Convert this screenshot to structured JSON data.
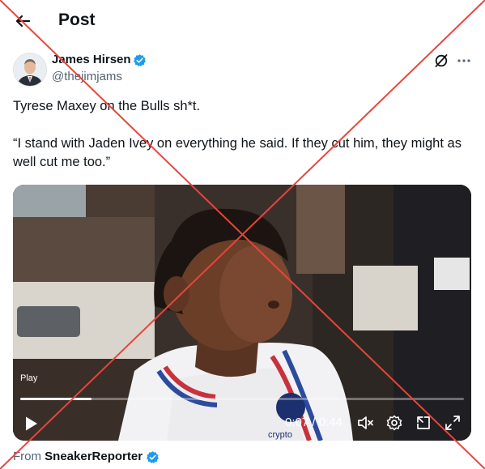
{
  "header": {
    "title": "Post",
    "back_icon": "arrow-left-icon"
  },
  "author": {
    "name": "James Hirsen",
    "handle": "@thejimjams",
    "verified": true
  },
  "actions": {
    "grok_icon": "grok-icon",
    "more_icon": "more-horizontal-icon"
  },
  "tweet": {
    "line1": "Tyrese Maxey on the Bulls sh*t.",
    "line2": "“I stand with Jaden Ivey on everything he said. If they cut him, they might as well cut me too.”"
  },
  "video": {
    "play_label": "Play",
    "current_time": "0:07",
    "duration": "0:44",
    "time_display": "0:07 / 0:44",
    "progress": 0.16,
    "jersey_logo_text": "crypto",
    "controls": [
      "play-icon",
      "mute-icon",
      "settings-icon",
      "pop-out-icon",
      "fullscreen-icon"
    ]
  },
  "attribution": {
    "from_label": "From",
    "source": "SneakerReporter",
    "verified": true
  },
  "overlay": {
    "color": "#e8453c"
  },
  "colors": {
    "text": "#0f1419",
    "secondary": "#536471",
    "verified_blue": "#1d9bf0"
  }
}
